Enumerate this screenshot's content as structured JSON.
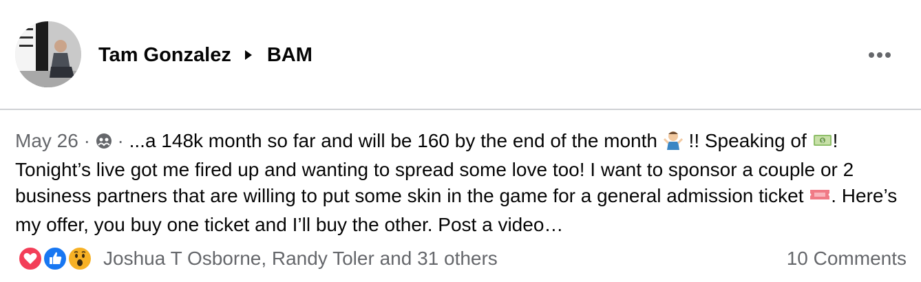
{
  "post": {
    "author": "Tam Gonzalez",
    "group": "BAM",
    "date": "May 26",
    "separator": " · ",
    "text_part1": "...a 148k month so far and will be 160 by the end of the month ",
    "text_part2": " !! Speaking of ",
    "text_part3": "! Tonight’s live got me fired up and wanting to spread some love too! I want to sponsor a couple or 2 business partners that are willing to put some skin in the game for a general admission ticket ",
    "text_part4": ". Here’s my offer, you buy one ticket and I’ll buy the other. Post a video…"
  },
  "footer": {
    "reactors": "Joshua T Osborne, Randy Toler and 31 others",
    "comments": "10 Comments"
  },
  "colors": {
    "secondary_text": "#65676b",
    "divider": "#ced0d4",
    "love": "#f33e58",
    "like": "#1877f2",
    "wow": "#f7b125"
  },
  "icons": {
    "privacy": "group-members-icon",
    "emoji_1": "person-shrugging-emoji",
    "emoji_2": "money-bag-emoji",
    "emoji_3": "ticket-emoji",
    "reactions": [
      "love-reaction-icon",
      "like-reaction-icon",
      "wow-reaction-icon"
    ]
  }
}
